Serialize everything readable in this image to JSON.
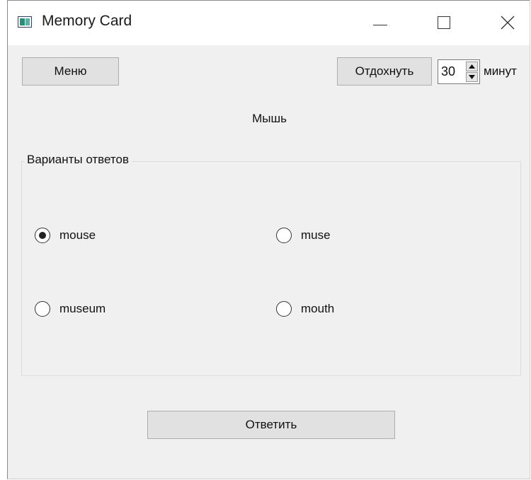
{
  "window": {
    "title": "Memory Card"
  },
  "toolbar": {
    "menu_label": "Меню",
    "rest_label": "Отдохнуть",
    "rest_minutes": "30",
    "rest_unit": "минут"
  },
  "question": {
    "text": "Мышь"
  },
  "answers": {
    "group_title": "Варианты ответов",
    "options": [
      {
        "label": "mouse",
        "checked": true
      },
      {
        "label": "muse",
        "checked": false
      },
      {
        "label": "museum",
        "checked": false
      },
      {
        "label": "mouth",
        "checked": false
      }
    ]
  },
  "actions": {
    "answer_label": "Ответить"
  },
  "icons": {
    "app": "app-window-icon",
    "minimize": "minimize-icon",
    "maximize": "maximize-icon",
    "close": "close-icon",
    "spin_up": "arrow-up-icon",
    "spin_down": "arrow-down-icon"
  }
}
